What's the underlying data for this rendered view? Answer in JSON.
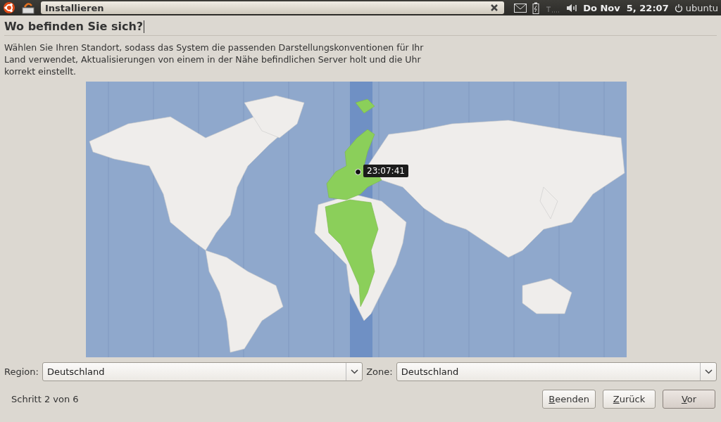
{
  "top_panel": {
    "window_button": {
      "title": "Installieren"
    },
    "clock": "Do Nov  5, 22:07",
    "user": "ubuntu"
  },
  "page": {
    "heading": "Wo befinden Sie sich?",
    "description": "Wählen Sie Ihren Standort, sodass das System die passenden Darstellungskonventionen für Ihr Land verwendet, Aktualisierungen von einem in der Nähe befindlichen Server holt und die Uhr korrekt einstellt."
  },
  "map": {
    "marker_time": "23:07:41"
  },
  "selectors": [
    {
      "label": "Region:",
      "value": "Deutschland"
    },
    {
      "label": "Zone:",
      "value": "Deutschland"
    }
  ],
  "status": "Schritt 2 von 6",
  "buttons": [
    {
      "access_key": "B",
      "label_rest": "eenden",
      "default": false
    },
    {
      "access_key": "Z",
      "label_rest": "urück",
      "default": false
    },
    {
      "access_key": "V",
      "label_rest": "or",
      "default": true
    }
  ]
}
